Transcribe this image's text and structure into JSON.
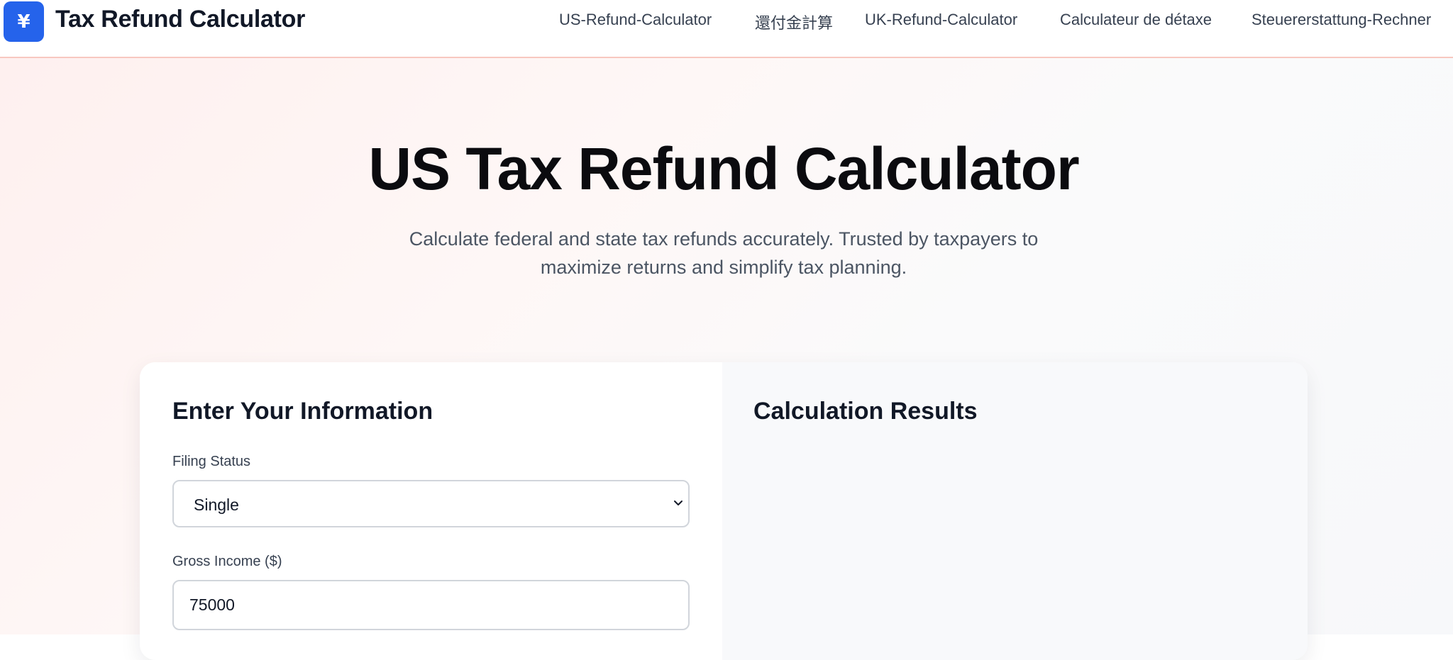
{
  "header": {
    "logo_symbol": "¥",
    "brand_title": "Tax Refund Calculator",
    "nav": [
      {
        "label": "US-Refund-Calculator"
      },
      {
        "label": "還付金計算"
      },
      {
        "label": "UK-Refund-Calculator"
      },
      {
        "label": "Calculateur de détaxe"
      },
      {
        "label": "Steuererstattung-Rechner"
      }
    ]
  },
  "hero": {
    "title": "US Tax Refund Calculator",
    "subtitle": "Calculate federal and state tax refunds accurately. Trusted by taxpayers to maximize returns and simplify tax planning."
  },
  "form": {
    "title": "Enter Your Information",
    "filing_status_label": "Filing Status",
    "filing_status_value": "Single",
    "gross_income_label": "Gross Income ($)",
    "gross_income_value": "75000"
  },
  "results": {
    "title": "Calculation Results"
  },
  "colors": {
    "accent": "#2563eb",
    "header_border": "#f8c8c0",
    "hero_bg": "#fef0ef",
    "results_bg": "#f8f9fb"
  },
  "icons": {
    "logo": "yen-icon",
    "select": "chevron-down-icon"
  }
}
